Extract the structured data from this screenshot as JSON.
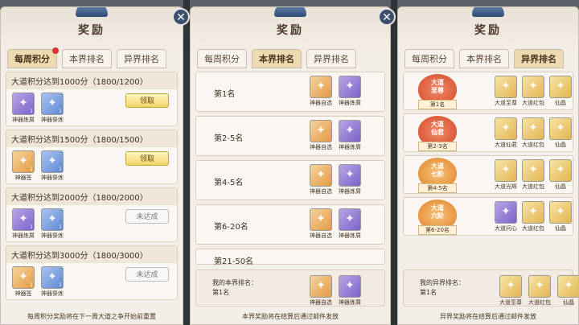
{
  "panel1": {
    "title": "奖励",
    "tabs": [
      "每周积分",
      "本界排名",
      "异界排名"
    ],
    "rows": [
      {
        "title": "大道积分达到1000分（1800/1200）",
        "items": [
          {
            "name": "神器炼屑",
            "color": "purple",
            "count": "1"
          },
          {
            "name": "神器祭炼",
            "color": "blue",
            "count": "1"
          }
        ],
        "button": "领取",
        "button_state": "claim"
      },
      {
        "title": "大道积分达到1500分（1800/1500）",
        "items": [
          {
            "name": "神器签",
            "color": "orange",
            "count": "1"
          },
          {
            "name": "神器祭炼",
            "color": "blue",
            "count": "1"
          }
        ],
        "button": "领取",
        "button_state": "claim"
      },
      {
        "title": "大道积分达到2000分（1800/2000）",
        "items": [
          {
            "name": "神器炼屑",
            "color": "purple",
            "count": "1"
          },
          {
            "name": "神器祭炼",
            "color": "blue",
            "count": "1"
          }
        ],
        "button": "未达成",
        "button_state": "no"
      },
      {
        "title": "大道积分达到3000分（1800/3000）",
        "items": [
          {
            "name": "神器签",
            "color": "orange",
            "count": "1"
          },
          {
            "name": "神器祭炼",
            "color": "blue",
            "count": "1"
          }
        ],
        "button": "未达成",
        "button_state": "no"
      }
    ],
    "footer": "每周积分奖励将在下一周大道之争开始前重置"
  },
  "panel2": {
    "title": "奖励",
    "tabs": [
      "每周积分",
      "本界排名",
      "异界排名"
    ],
    "rows": [
      {
        "label": "第1名",
        "items": [
          {
            "name": "神器自选",
            "color": "orange"
          },
          {
            "name": "神器炼屑",
            "color": "purple"
          }
        ]
      },
      {
        "label": "第2-5名",
        "items": [
          {
            "name": "神器自选",
            "color": "orange"
          },
          {
            "name": "神器炼屑",
            "color": "purple"
          }
        ]
      },
      {
        "label": "第4-5名",
        "items": [
          {
            "name": "神器自选",
            "color": "orange"
          },
          {
            "name": "神器炼屑",
            "color": "purple"
          }
        ]
      },
      {
        "label": "第6-20名",
        "items": [
          {
            "name": "神器自选",
            "color": "orange"
          },
          {
            "name": "神器炼屑",
            "color": "purple"
          }
        ]
      }
    ],
    "partial_row_label": "第21-50名",
    "mine": {
      "label": "我的本界排名：",
      "rank": "第1名",
      "items": [
        {
          "name": "神器自选",
          "color": "orange"
        },
        {
          "name": "神器炼屑",
          "color": "purple"
        }
      ]
    },
    "footer": "本界奖励将在结算后通过邮件发放"
  },
  "panel3": {
    "title": "奖励",
    "tabs": [
      "每周积分",
      "本界排名",
      "异界排名"
    ],
    "rows": [
      {
        "badge": "大道\n至尊",
        "badge_color": "red",
        "rank": "第1名",
        "items": [
          {
            "name": "大道至尊",
            "color": "gold"
          },
          {
            "name": "大道红包",
            "color": "gold"
          },
          {
            "name": "仙晶",
            "color": "gold"
          }
        ]
      },
      {
        "badge": "大道\n仙君",
        "badge_color": "red",
        "rank": "第2-3名",
        "items": [
          {
            "name": "大道仙君",
            "color": "gold"
          },
          {
            "name": "大道红包",
            "color": "gold"
          },
          {
            "name": "仙晶",
            "color": "gold"
          }
        ]
      },
      {
        "badge": "大道\n七阶",
        "badge_color": "orange",
        "rank": "第4-5名",
        "items": [
          {
            "name": "大道光辉",
            "color": "gold"
          },
          {
            "name": "大道红包",
            "color": "gold"
          },
          {
            "name": "仙晶",
            "color": "gold"
          }
        ]
      },
      {
        "badge": "大道\n六阶",
        "badge_color": "orange",
        "rank": "第6-20名",
        "items": [
          {
            "name": "大道问心",
            "color": "purple"
          },
          {
            "name": "大道红包",
            "color": "gold"
          },
          {
            "name": "仙晶",
            "color": "gold"
          }
        ]
      }
    ],
    "mine": {
      "label": "我的异界排名：",
      "rank": "第1名",
      "items": [
        {
          "name": "大道至尊",
          "color": "gold"
        },
        {
          "name": "大道红包",
          "color": "gold"
        },
        {
          "name": "仙晶",
          "color": "gold"
        }
      ]
    },
    "footer": "异界奖励将在结算后通过邮件发放"
  },
  "icons": {
    "close": "✕",
    "item_symbol": "✦"
  }
}
